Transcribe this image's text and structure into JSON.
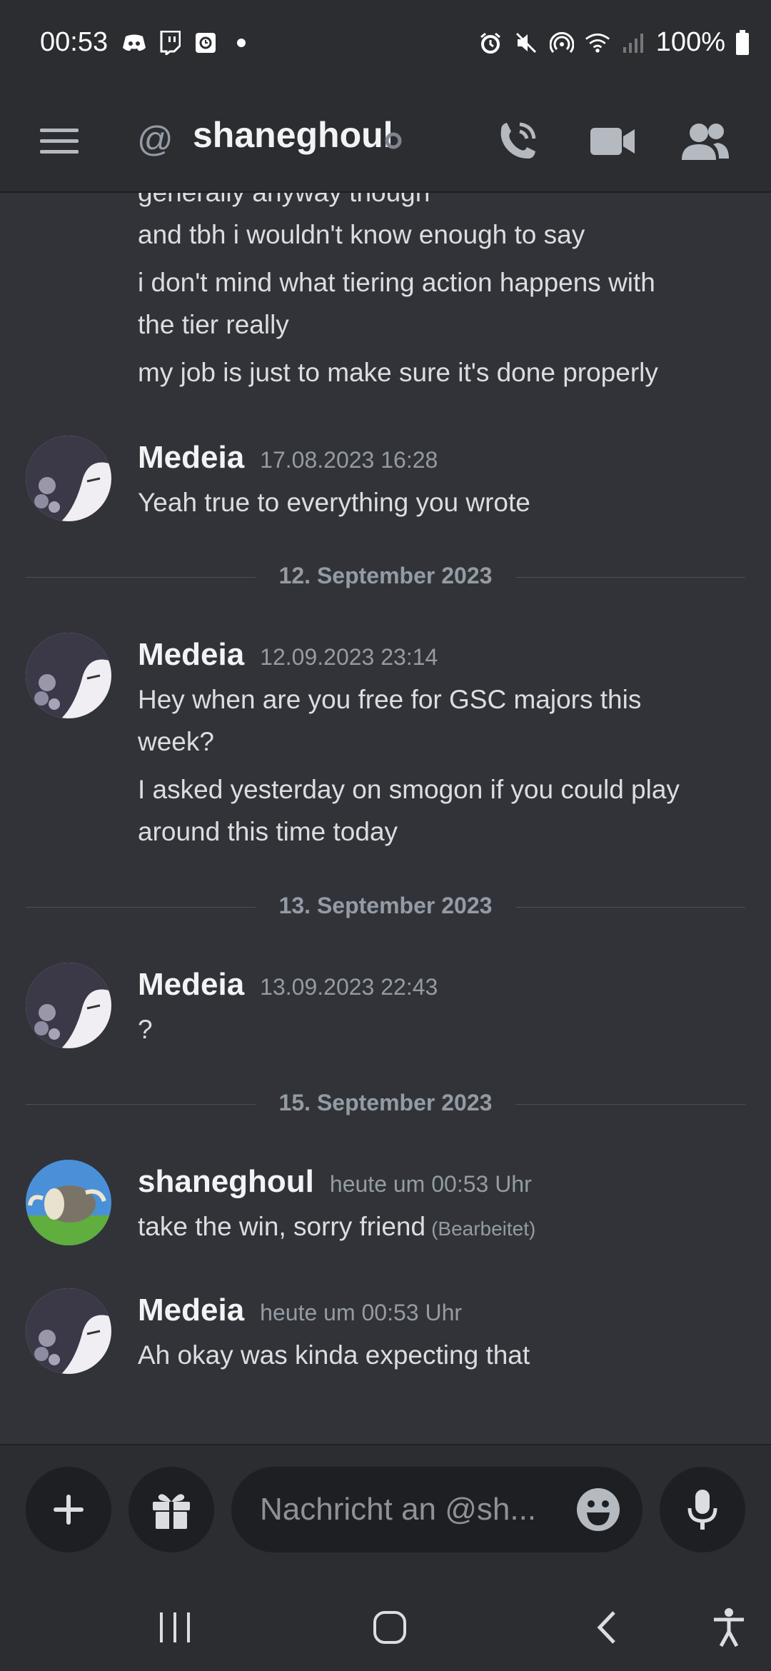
{
  "status_bar": {
    "time": "00:53",
    "battery": "100%",
    "left_icons": [
      "discord-icon",
      "twitch-icon",
      "clock-app-icon",
      "dot-icon"
    ],
    "right_icons": [
      "alarm-icon",
      "mute-icon",
      "hotspot-icon",
      "wifi-icon",
      "signal-icon",
      "battery-icon"
    ]
  },
  "header": {
    "at_symbol": "@",
    "title": "shaneghoul",
    "status": "offline"
  },
  "messages": {
    "continuation_lines": [
      "generally anyway though",
      "and tbh i wouldn't know enough to say",
      "i don't mind what tiering action happens with",
      "the tier really",
      "my job is just to make sure it's done properly"
    ],
    "groups": [
      {
        "author": "Medeia",
        "timestamp": "17.08.2023 16:28",
        "lines": [
          "Yeah true to everything you wrote"
        ]
      },
      {
        "author": "Medeia",
        "timestamp": "12.09.2023 23:14",
        "lines": [
          "Hey when are you free for GSC majors this",
          "week?",
          "I asked yesterday on smogon if you could play",
          "around this time today"
        ]
      },
      {
        "author": "Medeia",
        "timestamp": "13.09.2023 22:43",
        "lines": [
          "?"
        ]
      },
      {
        "author": "shaneghoul",
        "timestamp": "heute um 00:53 Uhr",
        "lines": [
          "take the win, sorry friend"
        ],
        "edited": "(Bearbeitet)"
      },
      {
        "author": "Medeia",
        "timestamp": "heute um 00:53 Uhr",
        "lines": [
          "Ah okay was kinda expecting that"
        ]
      }
    ],
    "dividers": [
      "12. September 2023",
      "13. September 2023",
      "15. September 2023"
    ]
  },
  "composer": {
    "placeholder": "Nachricht an @sh..."
  },
  "colors": {
    "background": "#313338",
    "header": "#2b2d31",
    "input": "#1e1f22",
    "text": "#dbdee1",
    "muted": "#949ba4"
  }
}
